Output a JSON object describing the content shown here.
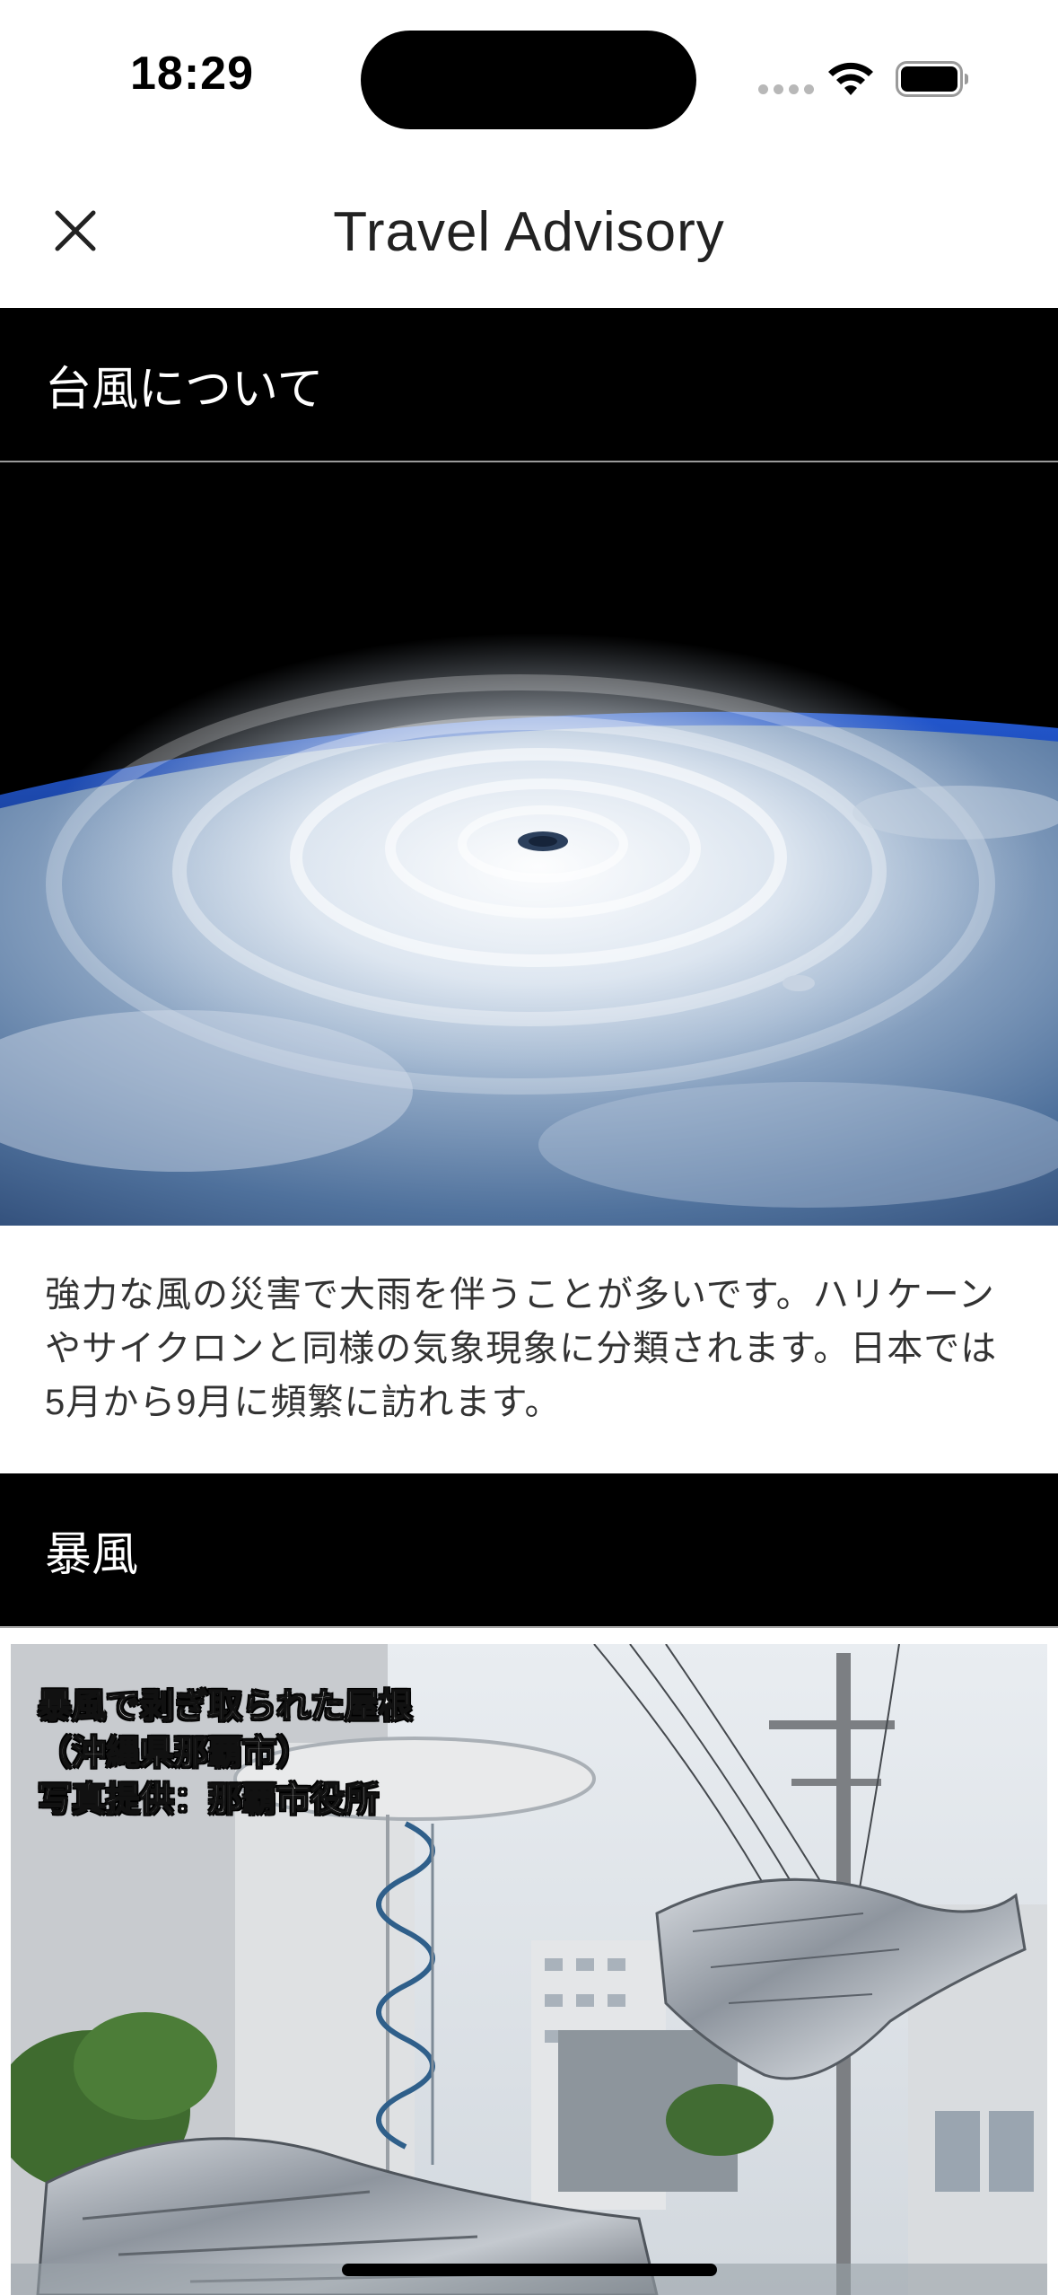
{
  "status_bar": {
    "time": "18:29"
  },
  "nav": {
    "title": "Travel Advisory",
    "close_icon": "close-icon"
  },
  "sections": [
    {
      "heading": "台風について",
      "image": "typhoon-satellite-image",
      "description": "強力な風の災害で大雨を伴うことが多いです。ハリケーンやサイクロンと同様の気象現象に分類されます。日本では5月から9月に頻繁に訪れます。"
    },
    {
      "heading": "暴風",
      "image": "storm-damage-photo",
      "caption_lines": [
        "暴風で剥ぎ取られた屋根",
        "（沖縄県那覇市）",
        "写真提供：那覇市役所"
      ]
    }
  ]
}
